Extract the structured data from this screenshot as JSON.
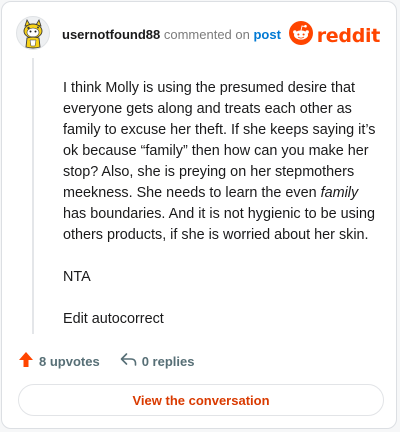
{
  "header": {
    "username": "usernotfound88",
    "verb": "commented on",
    "link_text": "post",
    "brand_name": "reddit",
    "brand_color": "#ff4500"
  },
  "comment": {
    "paragraphs": [
      {
        "before": "I think Molly is using the presumed desire that everyone gets along and treats each other as family to excuse her theft. If she keeps saying it’s ok because “family” then how can you make her stop? Also, she is preying on her stepmothers meekness. She needs to learn the even ",
        "emphasis": "family",
        "after": " has boundaries. And it is not hygienic to be using others products, if she is worried about her skin."
      },
      {
        "before": "NTA"
      },
      {
        "before": "Edit autocorrect"
      }
    ]
  },
  "actions": {
    "upvotes_label": "8 upvotes",
    "replies_label": "0 replies"
  },
  "cta": {
    "label": "View the conversation",
    "color": "#d93a00"
  },
  "icons": {
    "avatar": "snoo-avatar-icon",
    "brand": "reddit-logo-icon",
    "upvote": "upvote-arrow-icon",
    "reply": "reply-arrow-icon"
  }
}
